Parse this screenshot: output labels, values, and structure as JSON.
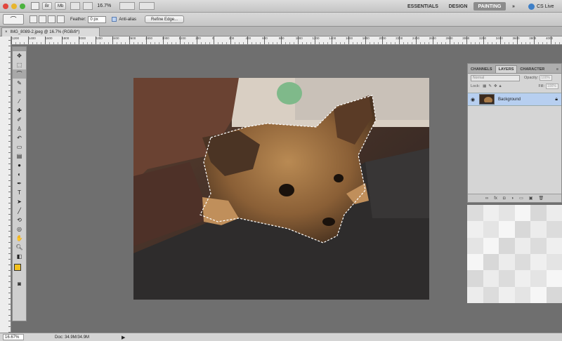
{
  "appbar": {
    "zoom": "16.7%",
    "buttons": [
      "Br",
      "Mb"
    ],
    "workspaces": [
      "ESSENTIALS",
      "DESIGN",
      "PAINTING"
    ],
    "active_workspace": "PAINTING",
    "more": "»",
    "cslive": "CS Live"
  },
  "options": {
    "feather_label": "Feather:",
    "feather_value": "0 px",
    "antialias_label": "Anti-alias",
    "refine_button": "Refine Edge..."
  },
  "tab": {
    "title": "IMG_8089-2.jpeg @ 16.7% (RGB/8*)",
    "close": "×"
  },
  "ruler": {
    "marks": [
      "1200",
      "1400",
      "1600",
      "1800",
      "2000",
      "2200",
      "2400",
      "2600",
      "2800",
      "3000",
      "1200",
      "200",
      "0",
      "200",
      "400",
      "600",
      "800",
      "1000",
      "1200",
      "1400",
      "1600",
      "1800",
      "2000",
      "2200",
      "2400",
      "2600",
      "2800",
      "3000",
      "3200",
      "3400",
      "3600",
      "3800",
      "4000"
    ]
  },
  "layers_panel": {
    "tabs": [
      "CHANNELS",
      "LAYERS",
      "CHARACTER"
    ],
    "active_tab": "LAYERS",
    "blend_mode": "Normal",
    "opacity_label": "Opacity:",
    "opacity_value": "100%",
    "lock_label": "Lock:",
    "fill_label": "Fill:",
    "fill_value": "100%",
    "layer_name": "Background"
  },
  "status": {
    "zoom": "16.67%",
    "doc": "Doc: 34.9M/34.9M"
  },
  "colors": {
    "foreground": "#f3c11d",
    "background": "#d71f1f",
    "layer_selected": "#b7cff0"
  }
}
